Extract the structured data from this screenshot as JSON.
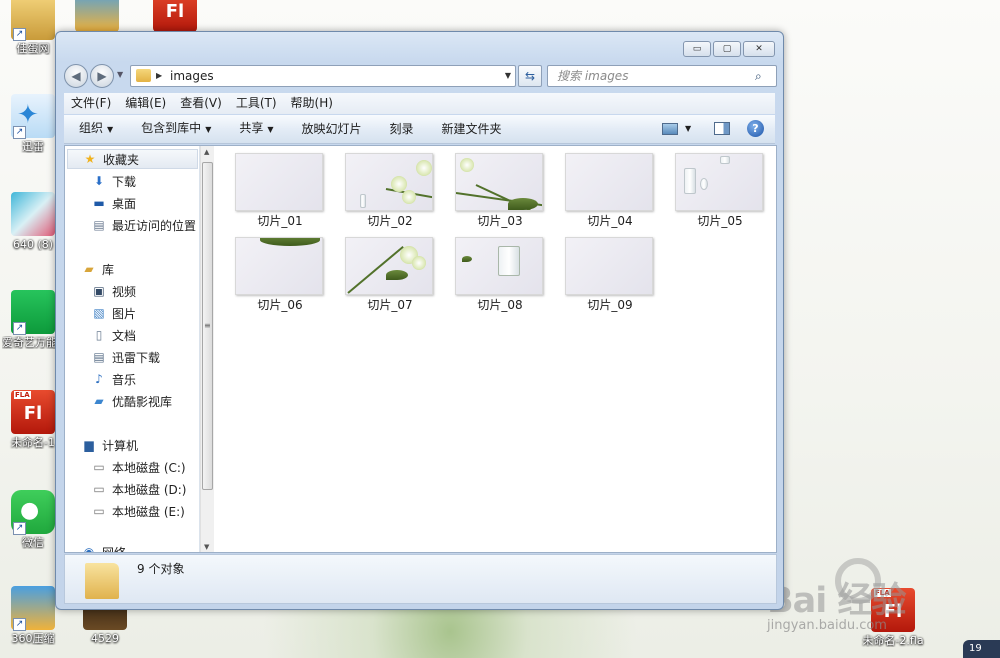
{
  "desktop": {
    "icons": [
      {
        "label": "佳蛋网"
      },
      {
        "label": "迅雷"
      },
      {
        "label": "640 (8)"
      },
      {
        "label": "爱奇艺万能播放器"
      },
      {
        "label": "未命名-1"
      },
      {
        "label": "微信"
      },
      {
        "label": "360压缩"
      },
      {
        "label": "4529"
      },
      {
        "label": "未命名-2.fla"
      }
    ],
    "fla_tag": "FLA",
    "fl_text": "Fl"
  },
  "window": {
    "controls": {
      "minimize": "▭",
      "maximize": "▢",
      "close": "✕"
    },
    "address": {
      "path": "images"
    },
    "search": {
      "placeholder": "搜索 images"
    },
    "menu": [
      "文件(F)",
      "编辑(E)",
      "查看(V)",
      "工具(T)",
      "帮助(H)"
    ],
    "toolbar": [
      "组织",
      "包含到库中",
      "共享",
      "放映幻灯片",
      "刻录",
      "新建文件夹"
    ],
    "nav": {
      "favorites": {
        "title": "收藏夹",
        "items": [
          "下载",
          "桌面",
          "最近访问的位置"
        ]
      },
      "library": {
        "title": "库",
        "items": [
          "视频",
          "图片",
          "文档",
          "迅雷下载",
          "音乐",
          "优酷影视库"
        ]
      },
      "computer": {
        "title": "计算机",
        "items": [
          "本地磁盘 (C:)",
          "本地磁盘 (D:)",
          "本地磁盘 (E:)"
        ]
      },
      "network": {
        "title": "网络"
      }
    },
    "files": [
      "切片_01",
      "切片_02",
      "切片_03",
      "切片_04",
      "切片_05",
      "切片_06",
      "切片_07",
      "切片_08",
      "切片_09"
    ],
    "status": {
      "count": "9 个对象"
    }
  },
  "watermark": {
    "brand": "Bai  经验",
    "sub": "jingyan.baidu.com"
  },
  "tray": {
    "text": "19"
  }
}
